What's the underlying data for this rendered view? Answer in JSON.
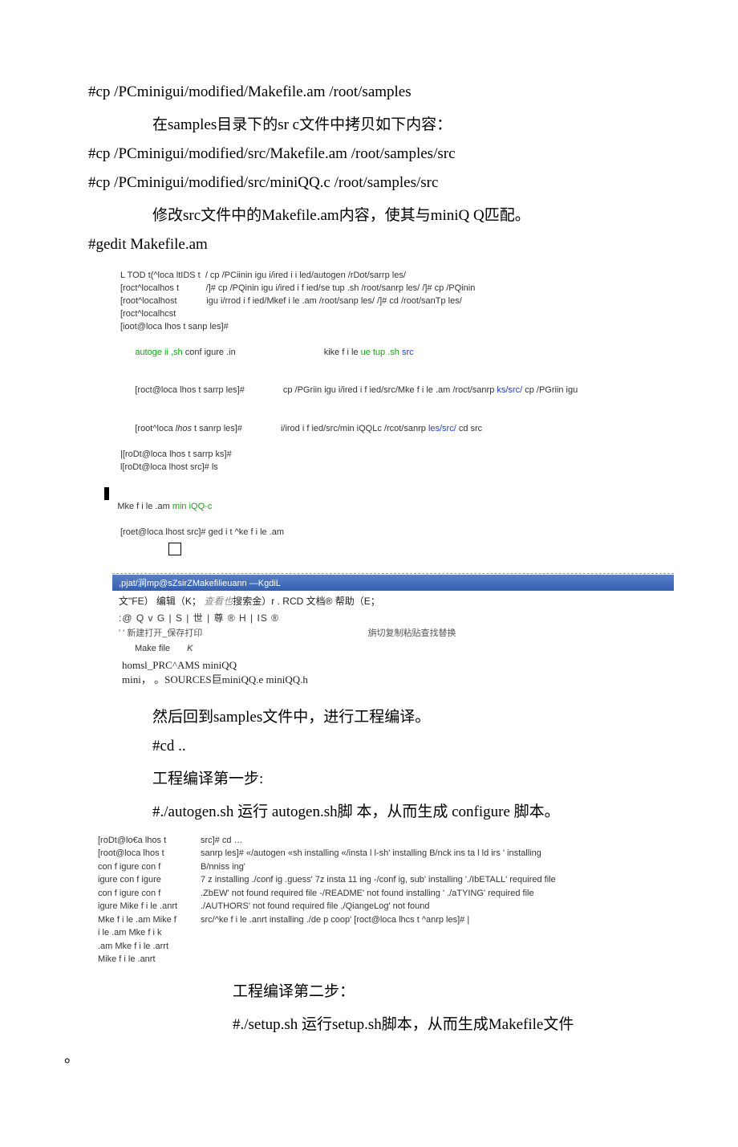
{
  "lines": {
    "cp1": "#cp /PCminigui/modified/Makefile.am /root/samples",
    "para1": "在samples目录下的sr c文件中拷贝如下内容：",
    "cp2": "#cp /PCminigui/modified/src/Makefile.am /root/samples/src",
    "cp3": "#cp /PCminigui/modified/src/miniQQ.c /root/samples/src",
    "para2": "修改src文件中的Makefile.am内容，使其与miniQ Q匹配。",
    "gedit": "#gedit Makefile.am"
  },
  "term1": {
    "l1": "L TOD t(^loca ltIDS t  / cp /PCiinin igu i/ired i i led/autogen /rDot/sarrp les/",
    "l2a": "[roct^localhos t           /]# cp /PQinin igu i/ired i f ied/se tup .sh /root/sanrp les/ /]# cp /PQinin",
    "l2b": "[root^localhost            igu i/rrod i f ied/Mkef i le .am /root/sanp les/ /]# cd /root/sanTp les/",
    "l3": "[roct^localhcst",
    "l4": "[ioot@loca lhos t sanp les]#",
    "l5a": "autoge ii ,sh",
    "l5b": " conf igure .in",
    "l5c": "kike f i le ",
    "l5d": "ue tup .sh ",
    "l5e": "src",
    "l6a": "[roct@loca lhos t sarrp les]#",
    "l6b": "cp /PGriin igu i/ired i f ied/src/Mke f i le .am /roct/sanrp ",
    "l6c": "ks/src/",
    "l6d": " cp /PGriin igu",
    "l7a": "[root^loca ",
    "l7a2": "lhos",
    "l7a3": " t sanrp les]#",
    "l7b": "i/irod i f ied/src/min iQQLc /rcot/sanrp ",
    "l7c": "les/src/",
    "l7d": " cd src",
    "l8": "|[roDt@loca lhos t sarrp ks]#",
    "l9": "l[roDt@loca lhost src]# ls",
    "l10a": "Mke f i le .am ",
    "l10b": "min iQQ-c",
    "l11": "[roet@loca lhost src]# ged i t ^ke f i le .am"
  },
  "editor": {
    "titlebar": ",pjat/涧mp@sZsirZMakefilieuann  —KgdiL",
    "menu": "文\"FE）    编辑（K；   查看也搜索金）r . RCD   文档®  帮助（E；",
    "toolbar": ":@ Q v G | S | 世 | 尊 ® H | IS ®",
    "toolbar_labels_left": "' ' 新建打开_保存打印",
    "toolbar_labels_right": "旃切复制粘贴查找替换",
    "tab": "Make file",
    "tab_k": "K",
    "body1": "homsl_PRC^AMS miniQQ",
    "body2": "mini， 。SOURCES巨miniQQ.e miniQQ.h"
  },
  "mid": {
    "p1": "然后回到samples文件中，进行工程编译。",
    "p2": "#cd ..",
    "p3": "工程编译第一步:",
    "p4": "#./autogen.sh    运行  autogen.sh脚  本，从而生成  configure 脚本。"
  },
  "term2": {
    "left": "[roDt@lo€a lhos t\n[root@loca lhos t\ncon f igure con f\nigure con f igure\ncon f igure con f\nigure Mike f i le .anrt\nMke f i le .am Mike f\ni le .am Mke f i k\n.am Mke f i le .arrt\nMike f i le .anrt",
    "r1": "src]# cd …",
    "r2": "sanrp les]# «/autogen «sh installing «/insta l l-sh' installing B/nck ins ta l ld irs ' installing",
    "r3": "B/nniss ing'",
    "r4": "7 z installing ./conf ig .guess' 7z insta 11 ing -/conf ig, sub' installing './IbETALL' required file",
    "r5": ".ZbEW' not found required file -/README' not found installing ' ./aTYING' required file",
    "r6": "./AUTHORS' not found required file ,/QiangeLog' not found",
    "r7": "src/^ke f i le .anrt installing ./de p coop' [roct@loca lhcs t ^anrp les]# |"
  },
  "tail": {
    "p1": "工程编译第二步：",
    "p2": "#./setup.sh   运行setup.sh脚本，从而生成Makefile文件",
    "period": "。"
  }
}
